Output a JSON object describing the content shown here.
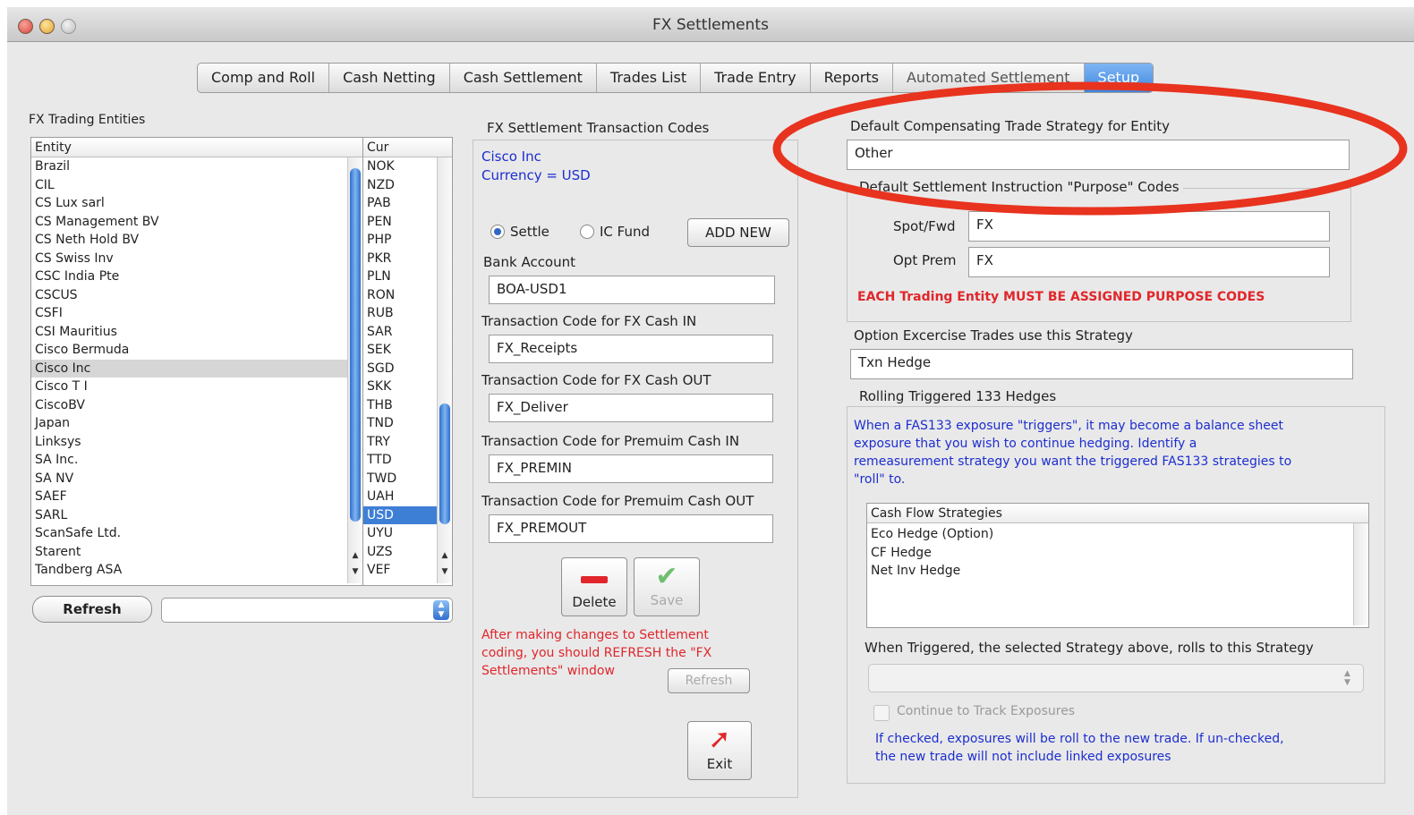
{
  "window": {
    "title": "FX Settlements"
  },
  "tabs": [
    {
      "label": "Comp and Roll",
      "active": false
    },
    {
      "label": "Cash Netting",
      "active": false
    },
    {
      "label": "Cash Settlement",
      "active": false
    },
    {
      "label": "Trades List",
      "active": false
    },
    {
      "label": "Trade Entry",
      "active": false
    },
    {
      "label": "Reports",
      "active": false
    },
    {
      "label": "Automated Settlement",
      "active": false
    },
    {
      "label": "Setup",
      "active": true
    }
  ],
  "entities": {
    "section_label": "FX Trading Entities",
    "col_entity": "Entity",
    "col_cur": "Cur",
    "rows": [
      "Brazil",
      "CIL",
      "CS Lux sarl",
      "CS Management BV",
      "CS Neth Hold BV",
      "CS Swiss Inv",
      "CSC India Pte",
      "CSCUS",
      "CSFI",
      "CSI Mauritius",
      "Cisco Bermuda",
      "Cisco Inc",
      "Cisco T I",
      "CiscoBV",
      "Japan",
      "Linksys",
      "SA Inc.",
      "SA NV",
      "SAEF",
      "SARL",
      "ScanSafe Ltd.",
      "Starent",
      "Tandberg ASA"
    ],
    "selected": "Cisco Inc",
    "currencies": [
      "NOK",
      "NZD",
      "PAB",
      "PEN",
      "PHP",
      "PKR",
      "PLN",
      "RON",
      "RUB",
      "SAR",
      "SEK",
      "SGD",
      "SKK",
      "THB",
      "TND",
      "TRY",
      "TTD",
      "TWD",
      "UAH",
      "USD",
      "UYU",
      "UZS",
      "VEF"
    ],
    "selected_currency": "USD",
    "refresh_label": "Refresh",
    "popup_value": ""
  },
  "transaction_codes": {
    "section_label": "FX Settlement Transaction Codes",
    "entity_name": "Cisco Inc",
    "currency_line": "Currency = USD",
    "settle_label": "Settle",
    "ic_fund_label": "IC Fund",
    "add_new_label": "ADD NEW",
    "bank_account_label": "Bank Account",
    "bank_account_value": "BOA-USD1",
    "cash_in_label": "Transaction Code for FX Cash IN",
    "cash_in_value": "FX_Receipts",
    "cash_out_label": "Transaction Code for FX Cash OUT",
    "cash_out_value": "FX_Deliver",
    "prem_in_label": "Transaction Code for Premuim Cash IN",
    "prem_in_value": "FX_PREMIN",
    "prem_out_label": "Transaction Code for Premuim Cash OUT",
    "prem_out_value": "FX_PREMOUT",
    "delete_label": "Delete",
    "save_label": "Save",
    "warning_text_1": "After making changes to Settlement",
    "warning_text_2": "coding, you should REFRESH the \"FX",
    "warning_text_3": "Settlements\" window",
    "refresh_label": "Refresh",
    "exit_label": "Exit"
  },
  "strategy": {
    "default_strategy_label": "Default Compensating Trade Strategy for Entity",
    "default_strategy_value": "Other",
    "purpose_codes_label": "Default Settlement Instruction \"Purpose\" Codes",
    "spot_label": "Spot/Fwd",
    "spot_value": "FX",
    "opt_label": "Opt Prem",
    "opt_value": "FX",
    "purpose_warning": "EACH Trading Entity MUST BE ASSIGNED PURPOSE CODES",
    "option_exercise_label": "Option Excercise Trades use this Strategy",
    "option_exercise_value": "Txn Hedge",
    "rolling_label": "Rolling Triggered 133 Hedges",
    "rolling_desc_1": "When a FAS133 exposure \"triggers\", it may become a balance sheet",
    "rolling_desc_2": "exposure that you wish to continue hedging.  Identify a",
    "rolling_desc_3": "remeasurement strategy you want the triggered FAS133 strategies to",
    "rolling_desc_4": "\"roll\" to.",
    "cash_flow_header": "Cash Flow Strategies",
    "cash_flow_items": [
      "Eco Hedge (Option)",
      "CF Hedge",
      "Net Inv Hedge"
    ],
    "when_triggered_label": "When Triggered, the selected Strategy above, rolls to this Strategy",
    "continue_label": "Continue to Track Exposures",
    "continue_note_1": "If checked, exposures will be roll to the new trade.  If un-checked,",
    "continue_note_2": "the new trade will not include linked exposures"
  },
  "colors": {
    "highlight_oval": "#e8331f",
    "accent": "#3e7fd6",
    "warning": "#e0262b",
    "info": "#1d2ecf"
  }
}
